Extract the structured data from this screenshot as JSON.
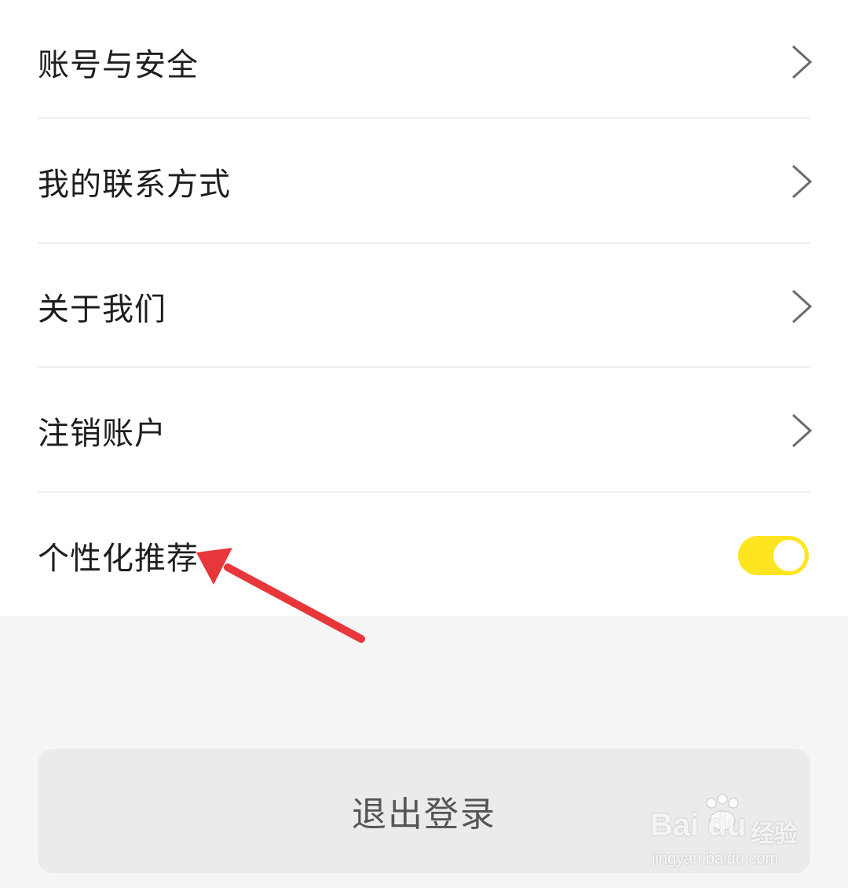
{
  "settings": {
    "items": [
      {
        "label": "账号与安全",
        "control": "chevron"
      },
      {
        "label": "我的联系方式",
        "control": "chevron"
      },
      {
        "label": "关于我们",
        "control": "chevron"
      },
      {
        "label": "注销账户",
        "control": "chevron"
      },
      {
        "label": "个性化推荐",
        "control": "toggle",
        "toggle_on": true
      }
    ],
    "toggle_color": "#ffe51f"
  },
  "logout": {
    "label": "退出登录"
  },
  "annotation": {
    "arrow_color": "#e8373a",
    "points_to": "个性化推荐"
  },
  "watermark": {
    "brand": "Bai du",
    "cn": "经验",
    "url": "jingyan.baidu.com"
  }
}
